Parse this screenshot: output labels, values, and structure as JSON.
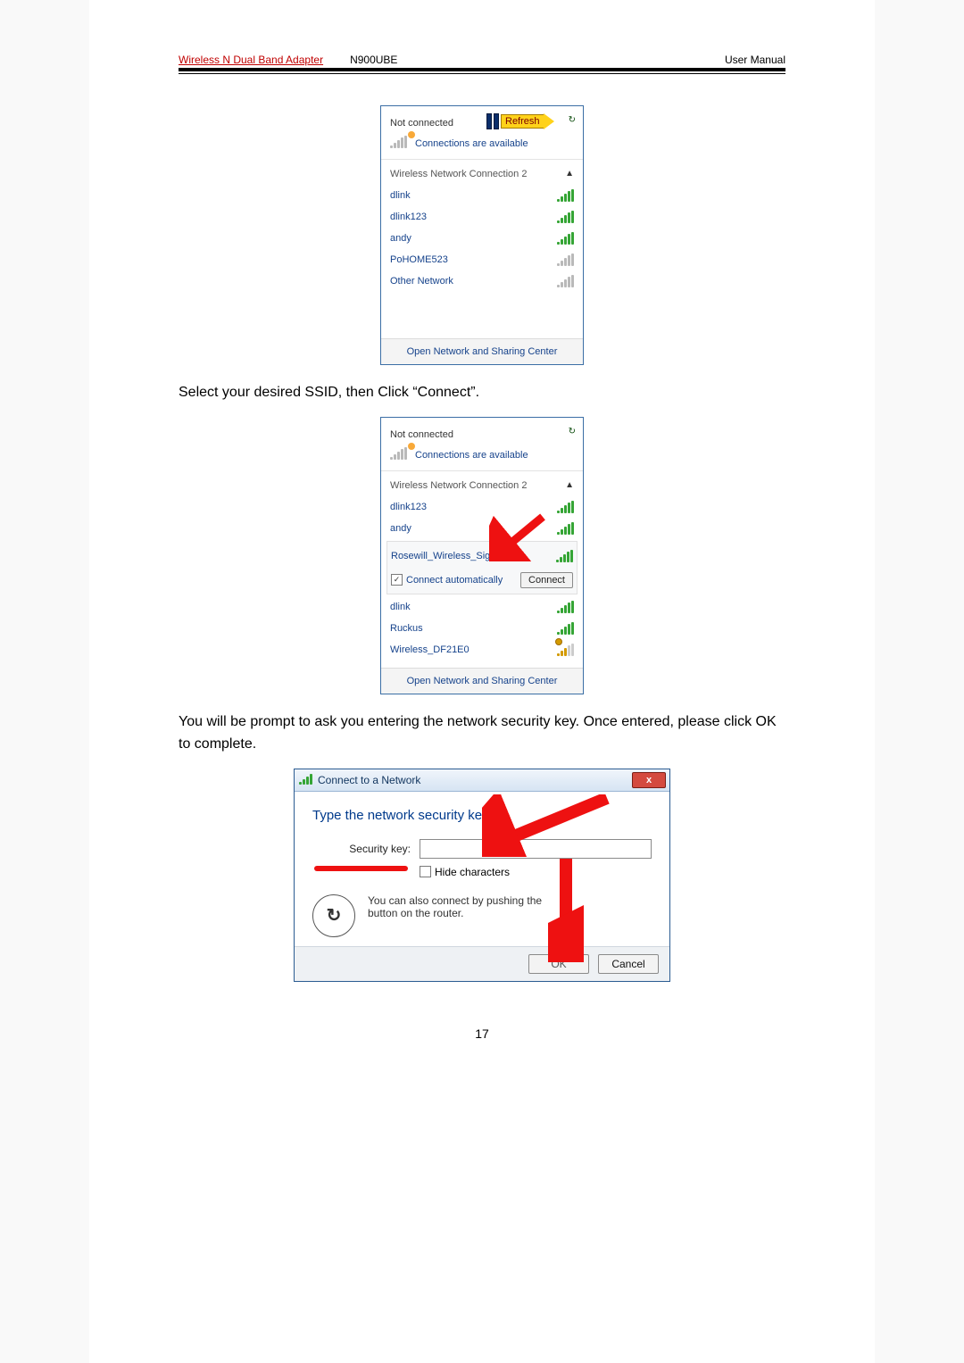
{
  "header": {
    "product": "Wireless N Dual Band Adapter",
    "model": "N900UBE",
    "doc": "User Manual"
  },
  "text": {
    "step1": "Select your desired SSID, then Click “Connect”.",
    "step2": "You will be prompt to ask you entering the network security key. Once entered, please click OK to complete."
  },
  "flyout1": {
    "status": "Not connected",
    "refresh": "Refresh",
    "avail": "Connections are available",
    "section": "Wireless Network Connection 2",
    "nets": [
      "dlink",
      "dlink123",
      "andy",
      "PoHOME523",
      "Other Network"
    ],
    "footer": "Open Network and Sharing Center"
  },
  "flyout2": {
    "status": "Not connected",
    "avail": "Connections are available",
    "section": "Wireless Network Connection 2",
    "netsA": [
      "dlink123",
      "andy"
    ],
    "selected": "Rosewill_Wireless_Signal",
    "auto": "Connect automatically",
    "connect": "Connect",
    "netsB": [
      "dlink",
      "Ruckus",
      "Wireless_DF21E0"
    ],
    "footer": "Open Network and Sharing Center"
  },
  "dialog": {
    "title": "Connect to a Network",
    "heading": "Type the network security key",
    "lbl": "Security key:",
    "hide": "Hide characters",
    "wps": "You can also connect by pushing the button on the router.",
    "ok": "OK",
    "cancel": "Cancel"
  },
  "page_number": "17"
}
